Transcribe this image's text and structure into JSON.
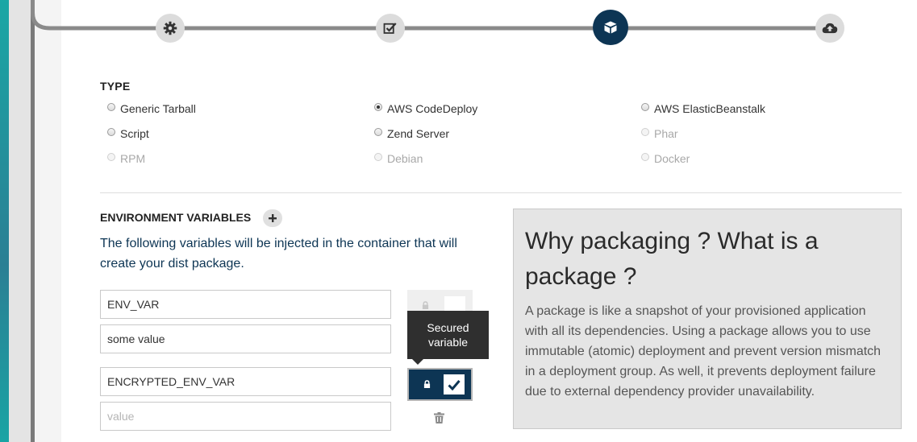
{
  "stepper": {
    "steps": [
      {
        "icon": "gear-icon",
        "state": "done"
      },
      {
        "icon": "checklist-icon",
        "state": "done"
      },
      {
        "icon": "package-icon",
        "state": "active"
      },
      {
        "icon": "cloud-upload-icon",
        "state": "pending"
      }
    ]
  },
  "type_section": {
    "title": "TYPE",
    "options": [
      {
        "label": "Generic Tarball",
        "checked": false,
        "disabled": false
      },
      {
        "label": "AWS CodeDeploy",
        "checked": true,
        "disabled": false
      },
      {
        "label": "AWS ElasticBeanstalk",
        "checked": false,
        "disabled": false
      },
      {
        "label": "Script",
        "checked": false,
        "disabled": false
      },
      {
        "label": "Zend Server",
        "checked": false,
        "disabled": false
      },
      {
        "label": "Phar",
        "checked": false,
        "disabled": true
      },
      {
        "label": "RPM",
        "checked": false,
        "disabled": true
      },
      {
        "label": "Debian",
        "checked": false,
        "disabled": true
      },
      {
        "label": "Docker",
        "checked": false,
        "disabled": true
      }
    ]
  },
  "env_section": {
    "title": "ENVIRONMENT VARIABLES",
    "description": "The following variables will be injected in the container that will create your dist package.",
    "variables": [
      {
        "name": "ENV_VAR",
        "value": "some value",
        "value_placeholder": "value",
        "secured": false
      },
      {
        "name": "ENCRYPTED_ENV_VAR",
        "value": "",
        "value_placeholder": "value",
        "secured": true
      }
    ],
    "tooltip": "Secured variable"
  },
  "info_panel": {
    "heading": "Why packaging ? What is a package ?",
    "body": "A package is like a snapshot of your provisioned application with all its dependencies. Using a package allows you to use immutable (atomic) deployment and prevent version mismatch in a deployment group. As well, it prevents deployment failure due to external dependency provider unavailability."
  },
  "colors": {
    "primary": "#0d3554",
    "step_inactive": "#dcdcdc",
    "info_bg": "#e5e5e5"
  }
}
